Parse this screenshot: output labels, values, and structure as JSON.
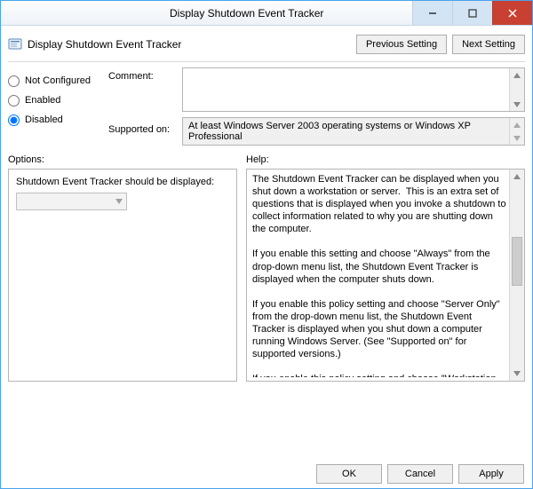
{
  "window": {
    "title": "Display Shutdown Event Tracker",
    "subtitle": "Display Shutdown Event Tracker"
  },
  "nav": {
    "previous": "Previous Setting",
    "next": "Next Setting"
  },
  "state": {
    "not_configured": "Not Configured",
    "enabled": "Enabled",
    "disabled": "Disabled",
    "selected": "disabled"
  },
  "fields": {
    "comment_label": "Comment:",
    "comment_value": "",
    "supported_label": "Supported on:",
    "supported_value": "At least Windows Server 2003 operating systems or Windows XP Professional"
  },
  "options": {
    "section_label": "Options:",
    "option_label": "Shutdown Event Tracker should be displayed:",
    "dropdown_value": ""
  },
  "help": {
    "section_label": "Help:",
    "text": "The Shutdown Event Tracker can be displayed when you shut down a workstation or server.  This is an extra set of questions that is displayed when you invoke a shutdown to collect information related to why you are shutting down the computer.\n\nIf you enable this setting and choose \"Always\" from the drop-down menu list, the Shutdown Event Tracker is displayed when the computer shuts down.\n\nIf you enable this policy setting and choose \"Server Only\" from the drop-down menu list, the Shutdown Event Tracker is displayed when you shut down a computer running Windows Server. (See \"Supported on\" for supported versions.)\n\nIf you enable this policy setting and choose \"Workstation Only\" from the drop-down menu list, the Shutdown Event Tracker is displayed when you shut down a computer running a client version of Windows. (See \"Supported on\" for supported versions.)\n\nIf you disable this policy setting, the Shutdown Event Tracker is"
  },
  "footer": {
    "ok": "OK",
    "cancel": "Cancel",
    "apply": "Apply"
  }
}
